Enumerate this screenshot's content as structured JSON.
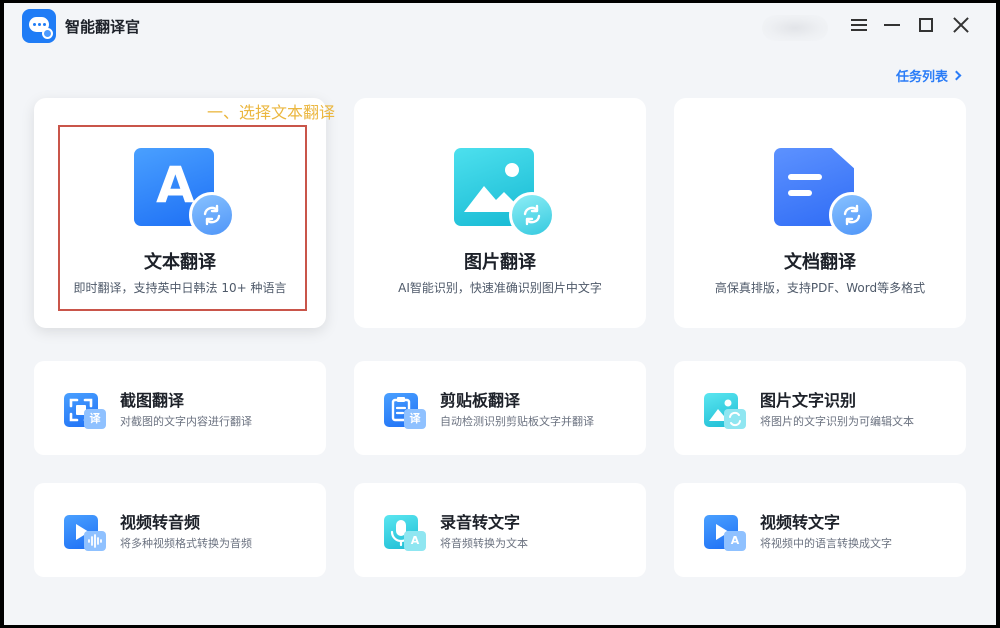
{
  "app": {
    "title": "智能翻译官"
  },
  "header": {
    "task_list_label": "任务列表"
  },
  "annotation": "一、选择文本翻译",
  "main_features": [
    {
      "title": "文本翻译",
      "desc": "即时翻译，支持英中日韩法 10+ 种语言",
      "icon": "text-translate-icon",
      "letter": "A"
    },
    {
      "title": "图片翻译",
      "desc": "AI智能识别，快速准确识别图片中文字",
      "icon": "image-translate-icon"
    },
    {
      "title": "文档翻译",
      "desc": "高保真排版，支持PDF、Word等多格式",
      "icon": "document-translate-icon"
    }
  ],
  "tools": [
    {
      "title": "截图翻译",
      "desc": "对截图的文字内容进行翻译",
      "badge": "译",
      "icon": "screenshot-icon"
    },
    {
      "title": "剪贴板翻译",
      "desc": "自动检测识别剪贴板文字并翻译",
      "badge": "译",
      "icon": "clipboard-icon"
    },
    {
      "title": "图片文字识别",
      "desc": "将图片的文字识别为可编辑文本",
      "badge": "",
      "icon": "image-ocr-icon"
    },
    {
      "title": "视频转音频",
      "desc": "将多种视频格式转换为音频",
      "badge": "",
      "icon": "video-to-audio-icon"
    },
    {
      "title": "录音转文字",
      "desc": "将音频转换为文本",
      "badge": "A",
      "icon": "microphone-icon"
    },
    {
      "title": "视频转文字",
      "desc": "将视频中的语言转换成文字",
      "badge": "A",
      "icon": "video-to-text-icon"
    }
  ],
  "colors": {
    "accent": "#2a7cf7",
    "highlight_border": "#c9554a",
    "annotation": "#ebb740"
  }
}
